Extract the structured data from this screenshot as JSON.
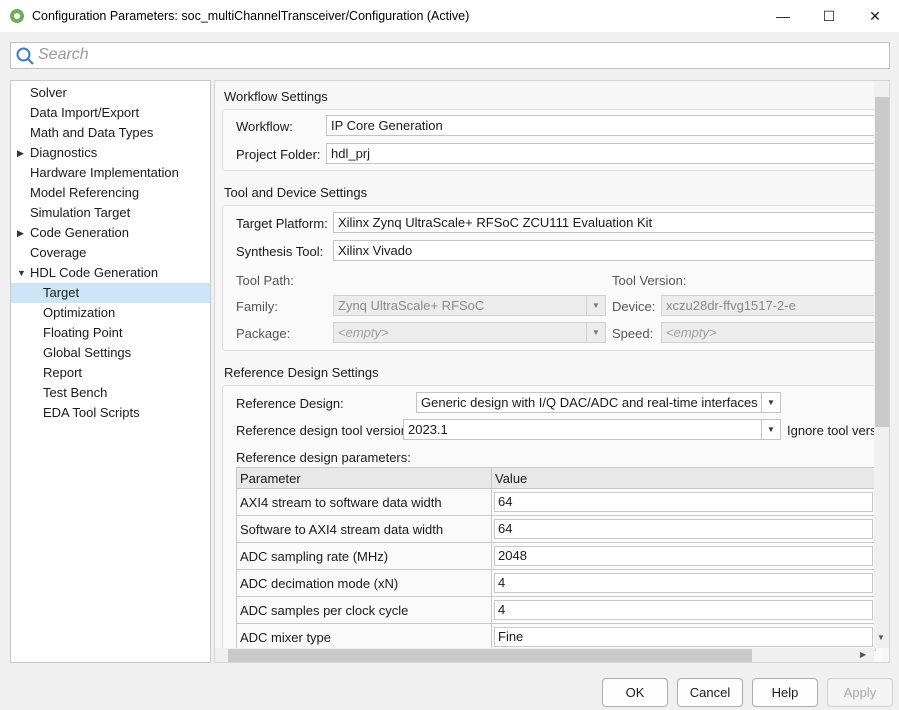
{
  "window": {
    "title": "Configuration Parameters: soc_multiChannelTransceiver/Configuration (Active)",
    "minimize": "—",
    "maximize": "☐",
    "close": "✕"
  },
  "search": {
    "placeholder": "Search"
  },
  "tree": [
    {
      "label": "Solver",
      "level": 0
    },
    {
      "label": "Data Import/Export",
      "level": 0
    },
    {
      "label": "Math and Data Types",
      "level": 0
    },
    {
      "label": "Diagnostics",
      "level": 0,
      "arrow": "▶"
    },
    {
      "label": "Hardware Implementation",
      "level": 0
    },
    {
      "label": "Model Referencing",
      "level": 0
    },
    {
      "label": "Simulation Target",
      "level": 0
    },
    {
      "label": "Code Generation",
      "level": 0,
      "arrow": "▶"
    },
    {
      "label": "Coverage",
      "level": 0
    },
    {
      "label": "HDL Code Generation",
      "level": 0,
      "arrow": "▼"
    },
    {
      "label": "Target",
      "level": 1,
      "selected": true
    },
    {
      "label": "Optimization",
      "level": 1
    },
    {
      "label": "Floating Point",
      "level": 1
    },
    {
      "label": "Global Settings",
      "level": 1
    },
    {
      "label": "Report",
      "level": 1
    },
    {
      "label": "Test Bench",
      "level": 1
    },
    {
      "label": "EDA Tool Scripts",
      "level": 1
    }
  ],
  "workflow": {
    "heading": "Workflow Settings",
    "workflow_label": "Workflow:",
    "workflow_value": "IP Core Generation",
    "folder_label": "Project Folder:",
    "folder_value": "hdl_prj"
  },
  "tool": {
    "heading": "Tool and Device Settings",
    "platform_label": "Target Platform:",
    "platform_value": "Xilinx Zynq UltraScale+ RFSoC ZCU111 Evaluation Kit",
    "synth_label": "Synthesis Tool:",
    "synth_value": "Xilinx Vivado",
    "path_label": "Tool Path:",
    "version_label": "Tool Version:",
    "family_label": "Family:",
    "family_value": "Zynq UltraScale+ RFSoC",
    "device_label": "Device:",
    "device_value": "xczu28dr-ffvg1517-2-e",
    "package_label": "Package:",
    "package_value": "<empty>",
    "speed_label": "Speed:",
    "speed_value": "<empty>"
  },
  "ref": {
    "heading": "Reference Design Settings",
    "design_label": "Reference Design:",
    "design_value": "Generic design with I/Q DAC/ADC and real-time interfaces",
    "toolver_label": "Reference design tool version:",
    "toolver_value": "2023.1",
    "ignore_label": "Ignore tool vers",
    "params_label": "Reference design parameters:",
    "columns": [
      "Parameter",
      "Value"
    ],
    "rows": [
      [
        "AXI4 stream to software data width",
        "64"
      ],
      [
        "Software to AXI4 stream data width",
        "64"
      ],
      [
        "ADC sampling rate (MHz)",
        "2048"
      ],
      [
        "ADC decimation mode (xN)",
        "4"
      ],
      [
        "ADC samples per clock cycle",
        "4"
      ],
      [
        "ADC mixer type",
        "Fine"
      ]
    ]
  },
  "buttons": {
    "ok": "OK",
    "cancel": "Cancel",
    "help": "Help",
    "apply": "Apply"
  }
}
